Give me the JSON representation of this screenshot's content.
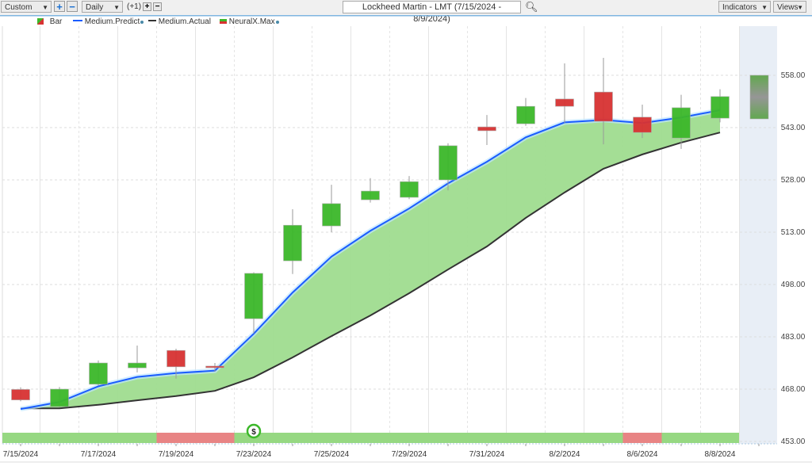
{
  "toolbar": {
    "period_select": "Custom",
    "interval_select": "Daily",
    "offset_label": "(+1)",
    "title": "Lockheed Martin - LMT (7/15/2024 - 8/9/2024)",
    "indicators_button": "Indicators",
    "views_button": "Views"
  },
  "legend": [
    "Bar",
    "Medium.Predict",
    "Medium.Actual",
    "NeuralX.Max"
  ],
  "colors": {
    "up": "#3cb82a",
    "down": "#d83232",
    "predict": "#1a5cff",
    "actual": "#333333",
    "fill": "#9fdc8f",
    "strip_green": "#96d882",
    "strip_red": "#e88484"
  },
  "chart_data": {
    "type": "candlestick",
    "dates": [
      "7/15/2024",
      "7/16/2024",
      "7/17/2024",
      "7/18/2024",
      "7/19/2024",
      "7/22/2024",
      "7/23/2024",
      "7/24/2024",
      "7/25/2024",
      "7/26/2024",
      "7/29/2024",
      "7/30/2024",
      "7/31/2024",
      "8/1/2024",
      "8/2/2024",
      "8/5/2024",
      "8/6/2024",
      "8/7/2024",
      "8/8/2024"
    ],
    "x_tick_labels": [
      "7/15/2024",
      "7/17/2024",
      "7/19/2024",
      "7/23/2024",
      "7/25/2024",
      "7/29/2024",
      "7/31/2024",
      "8/2/2024",
      "8/6/2024",
      "8/8/2024"
    ],
    "y_tick_labels": [
      "558.00",
      "543.00",
      "528.00",
      "513.00",
      "498.00",
      "483.00",
      "468.00",
      "453.00"
    ],
    "ylim": [
      453,
      565
    ],
    "open": [
      467.9,
      463.0,
      469.4,
      474.1,
      479.1,
      474.6,
      488.2,
      504.8,
      514.8,
      522.3,
      523.0,
      528.0,
      543.2,
      544.1,
      551.2,
      553.2,
      546.0,
      540.0,
      545.7
    ],
    "close": [
      464.9,
      468.0,
      475.5,
      475.5,
      474.4,
      474.2,
      501.2,
      515.0,
      521.2,
      524.8,
      527.5,
      537.8,
      542.1,
      549.1,
      549.1,
      544.8,
      541.6,
      548.7,
      551.9
    ],
    "high": [
      468.5,
      468.6,
      476.2,
      480.5,
      479.6,
      475.5,
      501.5,
      519.6,
      526.6,
      528.5,
      529.1,
      538.5,
      546.6,
      551.5,
      561.4,
      563.0,
      549.6,
      552.4,
      554.0
    ],
    "low": [
      464.5,
      462.8,
      469.0,
      472.8,
      471.0,
      473.0,
      484.0,
      501.0,
      513.0,
      521.5,
      522.5,
      525.0,
      538.0,
      543.5,
      544.3,
      538.2,
      540.0,
      536.9,
      544.5
    ],
    "forecast": {
      "date": "8/9/2024",
      "top": 558.0,
      "bottom": 545.5
    },
    "medium_predict": [
      462.3,
      464.3,
      468.8,
      471.5,
      472.6,
      473.3,
      483.9,
      495.7,
      506.0,
      513.4,
      519.8,
      527.0,
      533.2,
      540.2,
      544.5,
      545.2,
      544.3,
      545.9,
      548.0
    ],
    "medium_actual": [
      462.5,
      462.5,
      463.5,
      464.8,
      466.0,
      467.5,
      471.4,
      477.1,
      483.2,
      489.1,
      495.5,
      502.3,
      508.9,
      517.1,
      524.4,
      531.2,
      535.3,
      538.7,
      541.6
    ],
    "neuralx_strip": [
      "up",
      "up",
      "up",
      "up",
      "down",
      "down",
      "up",
      "up",
      "up",
      "up",
      "up",
      "up",
      "up",
      "up",
      "up",
      "up",
      "down",
      "up",
      "up"
    ],
    "signal_marker": {
      "date": "7/23/2024",
      "label": "$"
    }
  }
}
